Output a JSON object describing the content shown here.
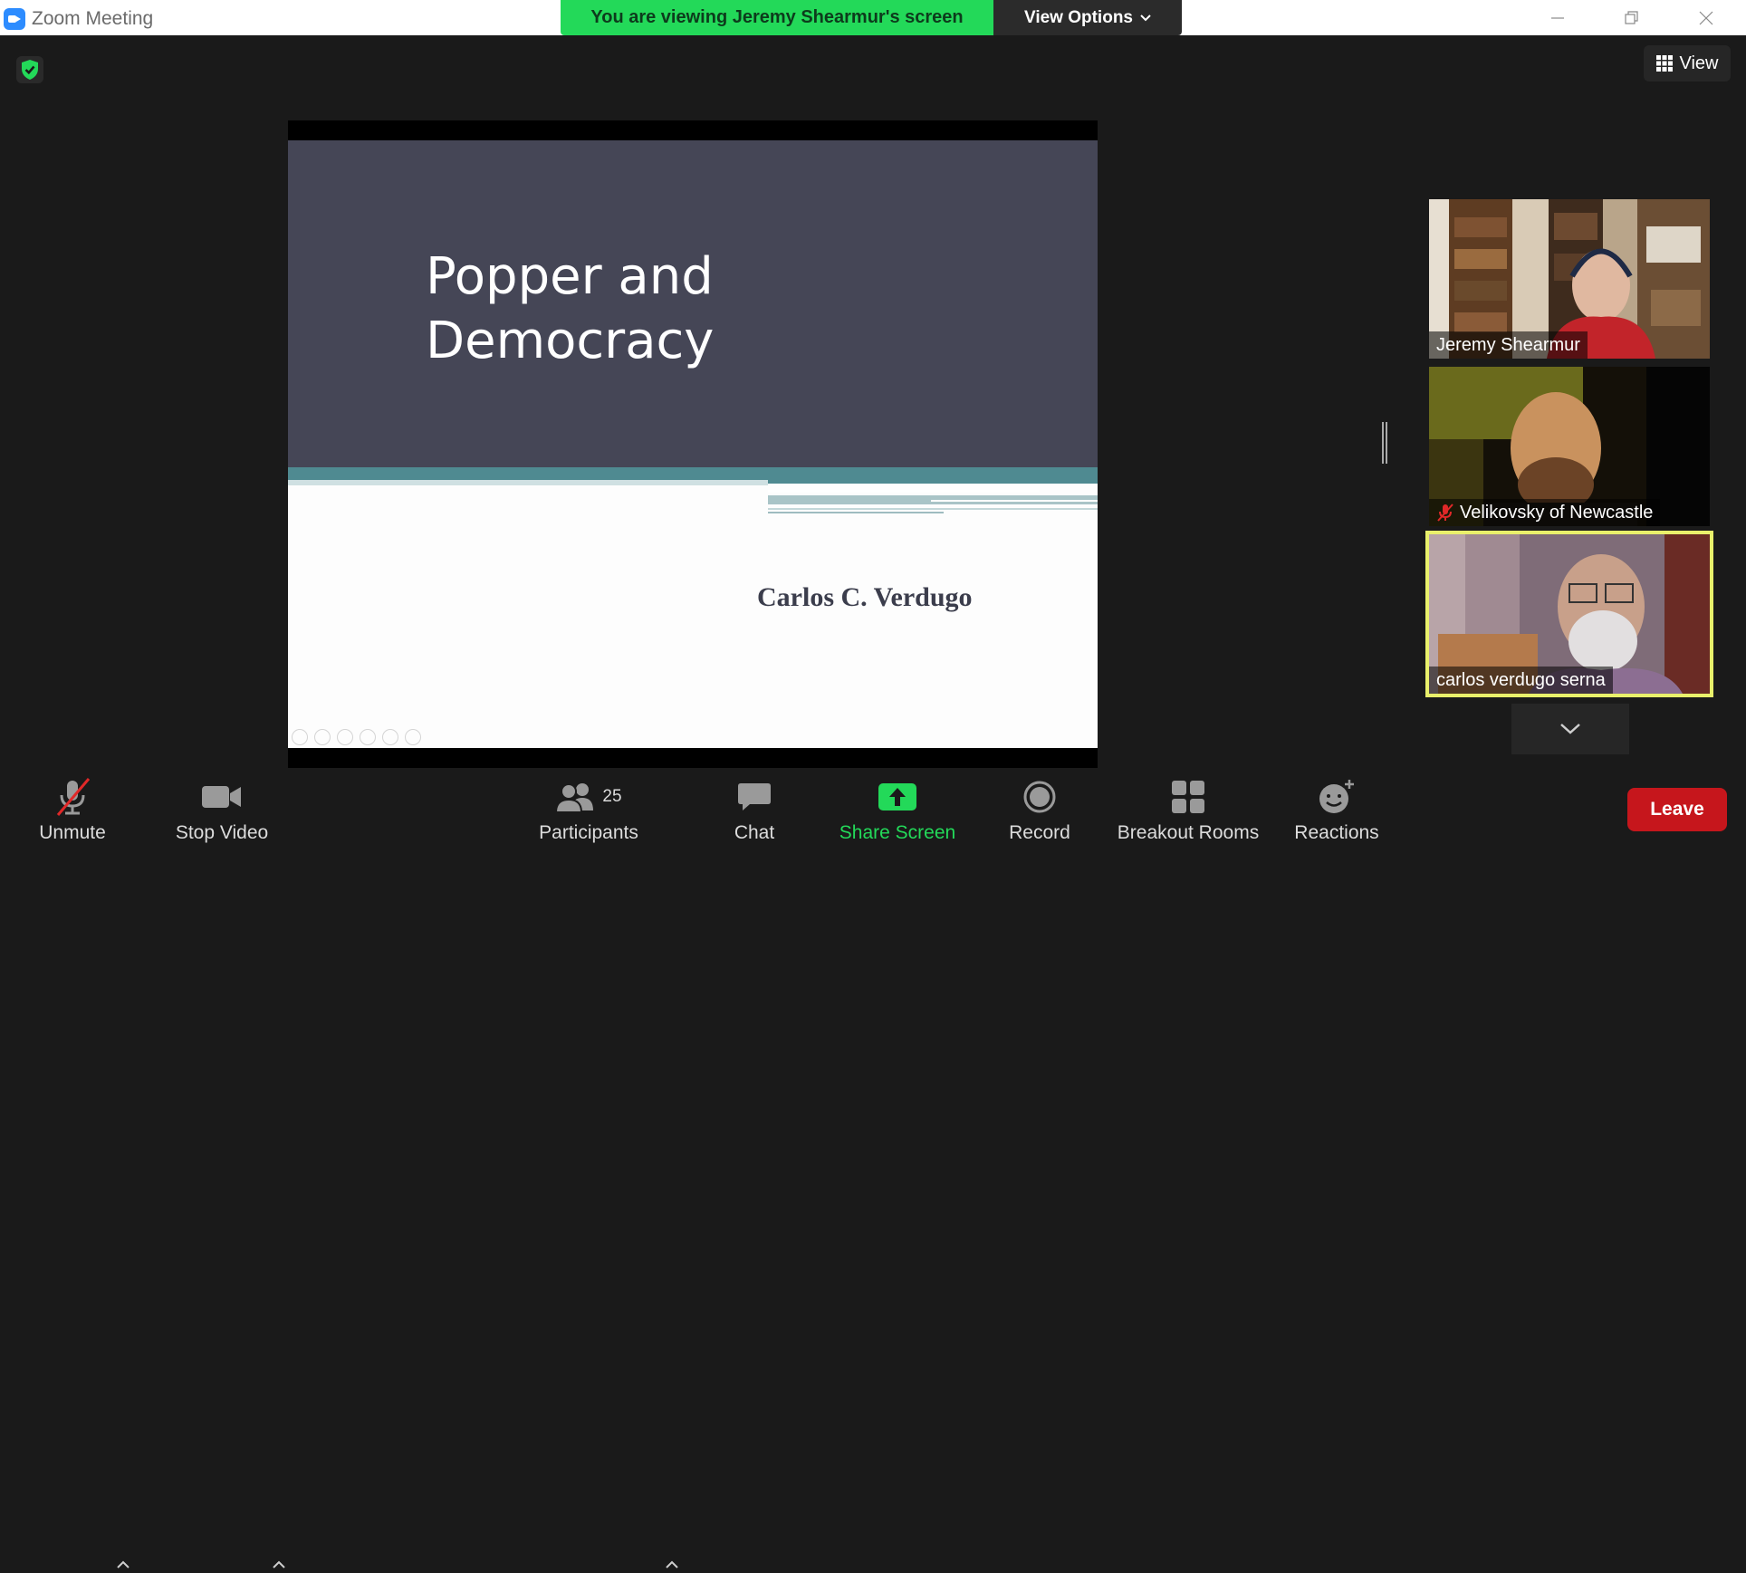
{
  "window": {
    "title": "Zoom Meeting"
  },
  "banner": {
    "viewing_text": "You are viewing Jeremy Shearmur's screen",
    "view_options_label": "View Options"
  },
  "view_button": {
    "label": "View"
  },
  "slide": {
    "title_line1": "Popper and",
    "title_line2": "Democracy",
    "author": "Carlos C. Verdugo"
  },
  "participants_videos": [
    {
      "name": "Jeremy Shearmur",
      "muted": false
    },
    {
      "name": "Velikovsky of Newcastle",
      "muted": true
    },
    {
      "name": "carlos verdugo serna",
      "muted": false,
      "active_speaker": true
    }
  ],
  "toolbar": {
    "unmute_label": "Unmute",
    "stop_video_label": "Stop Video",
    "participants_label": "Participants",
    "participants_count": "25",
    "chat_label": "Chat",
    "share_screen_label": "Share Screen",
    "record_label": "Record",
    "breakout_rooms_label": "Breakout Rooms",
    "reactions_label": "Reactions",
    "leave_label": "Leave"
  },
  "colors": {
    "accent_green": "#23d959",
    "leave_red": "#c6161c",
    "active_outline": "#e9f06b",
    "slide_header": "#454656"
  }
}
